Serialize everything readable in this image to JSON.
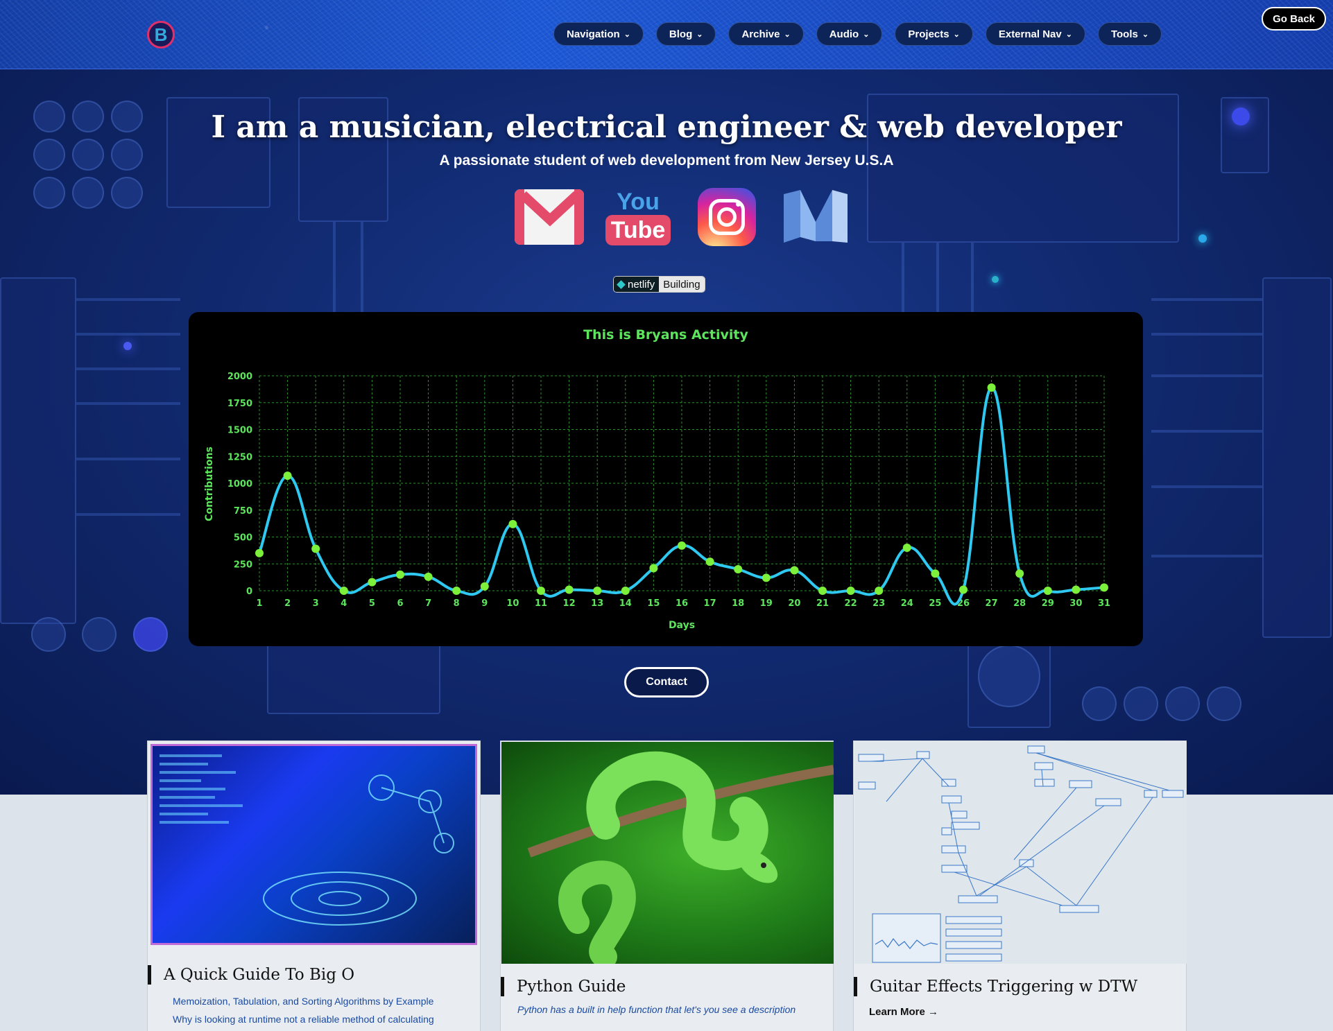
{
  "header": {
    "logo_letter": "B",
    "nav": [
      {
        "label": "Navigation"
      },
      {
        "label": "Blog"
      },
      {
        "label": "Archive"
      },
      {
        "label": "Audio"
      },
      {
        "label": "Projects"
      },
      {
        "label": "External Nav"
      },
      {
        "label": "Tools"
      }
    ],
    "chevron": "⌄",
    "go_back": "Go Back"
  },
  "hero": {
    "title": "I am a musician, electrical engineer & web developer",
    "subtitle": "A passionate student of web development from New Jersey U.S.A",
    "social": [
      "gmail-icon",
      "youtube-icon",
      "instagram-icon",
      "medium-icon"
    ],
    "youtube_you": "You",
    "youtube_tube": "Tube",
    "badge_left": "netlify",
    "badge_right": "Building",
    "contact_label": "Contact"
  },
  "chart_data": {
    "type": "line",
    "title": "This is Bryans Activity",
    "xlabel": "Days",
    "ylabel": "Contributions",
    "ylim": [
      0,
      2000
    ],
    "yticks": [
      0,
      250,
      500,
      750,
      1000,
      1250,
      1500,
      1750,
      2000
    ],
    "x": [
      1,
      2,
      3,
      4,
      5,
      6,
      7,
      8,
      9,
      10,
      11,
      12,
      13,
      14,
      15,
      16,
      17,
      18,
      19,
      20,
      21,
      22,
      23,
      24,
      25,
      26,
      27,
      28,
      29,
      30,
      31
    ],
    "series": [
      {
        "values": [
          350,
          1070,
          390,
          0,
          80,
          150,
          130,
          0,
          40,
          620,
          0,
          10,
          0,
          0,
          210,
          420,
          270,
          200,
          120,
          190,
          0,
          0,
          0,
          400,
          160,
          10,
          1890,
          160,
          0,
          10,
          30
        ]
      }
    ],
    "grid": true,
    "colors": {
      "line": "#2ec8f0",
      "points": "#7cf03a",
      "text": "#5de55d",
      "grid": "#2f8f2f"
    }
  },
  "cards": [
    {
      "title": "A Quick Guide To Big O",
      "lines": [
        "Memoization, Tabulation, and Sorting Algorithms by Example",
        "Why is looking at runtime not a reliable method of calculating"
      ]
    },
    {
      "title": "Python Guide",
      "italic": "Python has a built in help function that let's you see a description"
    },
    {
      "title": "Guitar Effects Triggering w DTW",
      "link": "Learn More →"
    }
  ]
}
